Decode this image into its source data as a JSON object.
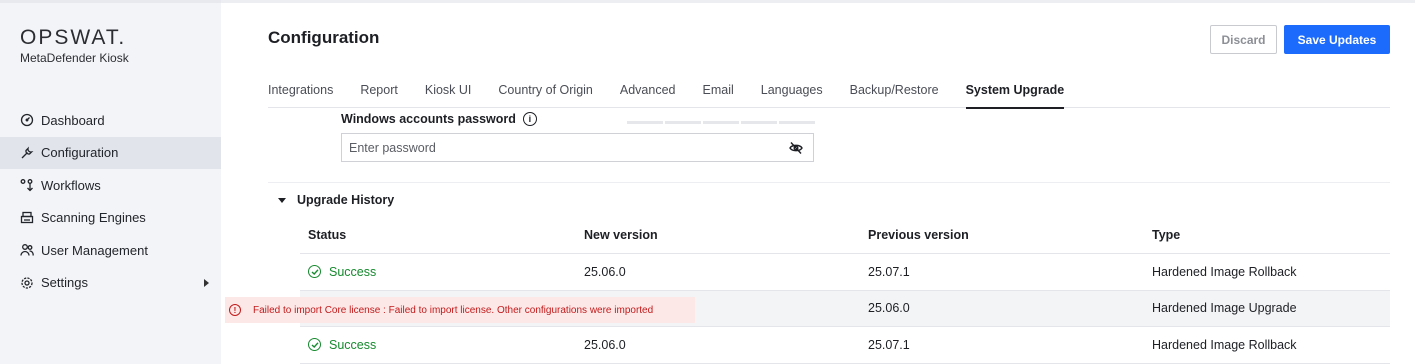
{
  "brand": {
    "logo": "OPSWAT.",
    "product": "MetaDefender Kiosk"
  },
  "sidebar": {
    "items": [
      {
        "label": "Dashboard",
        "icon": "gauge-icon",
        "active": false
      },
      {
        "label": "Configuration",
        "icon": "wrench-icon",
        "active": true
      },
      {
        "label": "Workflows",
        "icon": "workflow-icon",
        "active": false
      },
      {
        "label": "Scanning Engines",
        "icon": "printer-icon",
        "active": false
      },
      {
        "label": "User Management",
        "icon": "users-icon",
        "active": false
      },
      {
        "label": "Settings",
        "icon": "gear-icon",
        "active": false,
        "expandable": true
      }
    ]
  },
  "header": {
    "title": "Configuration",
    "discard_label": "Discard",
    "save_label": "Save Updates"
  },
  "tabs": [
    {
      "label": "Integrations"
    },
    {
      "label": "Report"
    },
    {
      "label": "Kiosk UI"
    },
    {
      "label": "Country of Origin"
    },
    {
      "label": "Advanced"
    },
    {
      "label": "Email"
    },
    {
      "label": "Languages"
    },
    {
      "label": "Backup/Restore"
    },
    {
      "label": "System Upgrade",
      "active": true
    }
  ],
  "password": {
    "label": "Windows accounts password",
    "placeholder": "Enter password",
    "value": ""
  },
  "history": {
    "title": "Upgrade History",
    "columns": [
      "Status",
      "New version",
      "Previous version",
      "Type"
    ],
    "rows": [
      {
        "status": "Success",
        "new_version": "25.06.0",
        "previous_version": "25.07.1",
        "type": "Hardened Image Rollback"
      },
      {
        "status": "Failed to import Core license : Failed to import license. Other configurations were imported",
        "new_version": "",
        "previous_version": "25.06.0",
        "type": "Hardened Image Upgrade"
      },
      {
        "status": "Success",
        "new_version": "25.06.0",
        "previous_version": "25.07.1",
        "type": "Hardened Image Rollback"
      }
    ]
  },
  "colors": {
    "accent": "#1d6bfc",
    "success": "#168a2e",
    "error": "#c21a1a",
    "error_bg": "#fde8e8"
  }
}
